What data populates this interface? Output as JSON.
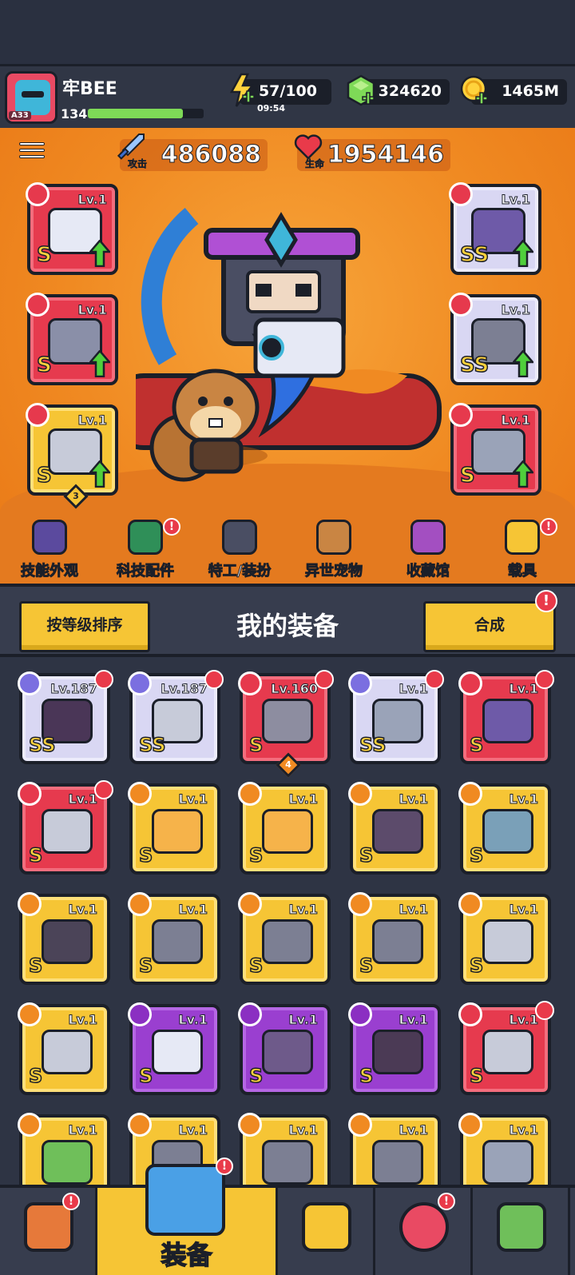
{
  "player": {
    "name": "牢BEE",
    "level": "134",
    "avatar_level": "A33",
    "xp_fraction": 0.82
  },
  "resources": {
    "energy": "57/100",
    "energy_timer": "09:54",
    "gems": "324620",
    "coins": "1465M"
  },
  "stats": {
    "attack_label": "攻击",
    "attack_value": "486088",
    "hp_label": "生命",
    "hp_value": "1954146"
  },
  "equipped_left": [
    {
      "level": "Lv.1",
      "rank": "S",
      "rarity": "red",
      "icon": "blaster-icon",
      "upgradable": true
    },
    {
      "level": "Lv.1",
      "rank": "S",
      "rarity": "red",
      "icon": "spiked-collar-icon",
      "upgradable": true
    },
    {
      "level": "Lv.1",
      "rank": "S",
      "rarity": "gold",
      "icon": "gauntlet-icon",
      "upgradable": true,
      "badge": "3"
    }
  ],
  "equipped_right": [
    {
      "level": "Lv.1",
      "rank": "SS",
      "rarity": "lav",
      "icon": "armor-icon",
      "upgradable": true
    },
    {
      "level": "Lv.1",
      "rank": "SS",
      "rarity": "lav",
      "icon": "belt-icon",
      "upgradable": true
    },
    {
      "level": "Lv.1",
      "rank": "S",
      "rarity": "red",
      "icon": "boot-icon",
      "upgradable": true
    }
  ],
  "hero_nav": [
    {
      "label": "技能外观",
      "icon": "skill-skin-icon",
      "alert": false
    },
    {
      "label": "科技配件",
      "icon": "tech-parts-icon",
      "alert": true
    },
    {
      "label": "特工/装扮",
      "icon": "agent-outfit-icon",
      "alert": false
    },
    {
      "label": "异世宠物",
      "icon": "pet-icon",
      "alert": false
    },
    {
      "label": "收藏馆",
      "icon": "collection-icon",
      "alert": false
    },
    {
      "label": "载具",
      "icon": "vehicle-icon",
      "alert": true
    }
  ],
  "toolbar": {
    "sort_label": "按等级排序",
    "title": "我的装备",
    "merge_label": "合成",
    "merge_alert": "!"
  },
  "inventory": [
    {
      "level": "Lv.187",
      "rank": "SS",
      "rarity": "lav",
      "icon": "staff-icon",
      "equipped": true
    },
    {
      "level": "Lv.187",
      "rank": "SS",
      "rarity": "lav",
      "icon": "glove-icon",
      "equipped": true
    },
    {
      "level": "Lv.160",
      "rank": "S",
      "rarity": "red",
      "icon": "chain-necklace-icon",
      "equipped": true,
      "badge": "4"
    },
    {
      "level": "Lv.1",
      "rank": "SS",
      "rarity": "lav",
      "icon": "boot-icon",
      "equipped": true
    },
    {
      "level": "Lv.1",
      "rank": "S",
      "rarity": "red",
      "icon": "armor-icon",
      "equipped": true
    },
    {
      "level": "Lv.1",
      "rank": "S",
      "rarity": "red",
      "icon": "gauntlet-icon",
      "equipped": true
    },
    {
      "level": "Lv.1",
      "rank": "S",
      "rarity": "gold",
      "icon": "sword-icon",
      "equipped": false
    },
    {
      "level": "Lv.1",
      "rank": "S",
      "rarity": "gold",
      "icon": "sword-icon",
      "equipped": false
    },
    {
      "level": "Lv.1",
      "rank": "S",
      "rarity": "gold",
      "icon": "spiked-blade-icon",
      "equipped": false
    },
    {
      "level": "Lv.1",
      "rank": "S",
      "rarity": "gold",
      "icon": "helmet-armor-icon",
      "equipped": false
    },
    {
      "level": "Lv.1",
      "rank": "S",
      "rarity": "gold",
      "icon": "dark-armor-icon",
      "equipped": false
    },
    {
      "level": "Lv.1",
      "rank": "S",
      "rarity": "gold",
      "icon": "belt-icon",
      "equipped": false
    },
    {
      "level": "Lv.1",
      "rank": "S",
      "rarity": "gold",
      "icon": "belt-icon",
      "equipped": false
    },
    {
      "level": "Lv.1",
      "rank": "S",
      "rarity": "gold",
      "icon": "belt-icon",
      "equipped": false
    },
    {
      "level": "Lv.1",
      "rank": "S",
      "rarity": "gold",
      "icon": "gauntlet-icon",
      "equipped": false
    },
    {
      "level": "Lv.1",
      "rank": "S",
      "rarity": "gold",
      "icon": "gauntlet-icon",
      "equipped": false
    },
    {
      "level": "Lv.1",
      "rank": "S",
      "rarity": "purple",
      "icon": "blaster-icon",
      "equipped": false
    },
    {
      "level": "Lv.1",
      "rank": "S",
      "rarity": "purple",
      "icon": "amulet-icon",
      "equipped": false
    },
    {
      "level": "Lv.1",
      "rank": "S",
      "rarity": "purple",
      "icon": "collar-icon",
      "equipped": false
    },
    {
      "level": "Lv.1",
      "rank": "S",
      "rarity": "red",
      "icon": "gauntlet-icon",
      "equipped": true
    },
    {
      "level": "Lv.1",
      "rank": "",
      "rarity": "gold",
      "icon": "green-gem-armor-icon",
      "equipped": false
    },
    {
      "level": "Lv.1",
      "rank": "",
      "rarity": "gold",
      "icon": "helmet-icon",
      "equipped": false
    },
    {
      "level": "Lv.1",
      "rank": "",
      "rarity": "gold",
      "icon": "belt-icon",
      "equipped": false
    },
    {
      "level": "Lv.1",
      "rank": "",
      "rarity": "gold",
      "icon": "belt-icon",
      "equipped": false
    },
    {
      "level": "Lv.1",
      "rank": "",
      "rarity": "gold",
      "icon": "boot-icon",
      "equipped": false
    }
  ],
  "bottom_nav": [
    {
      "label": "",
      "icon": "shop-icon",
      "alert": true
    },
    {
      "label": "装备",
      "icon": "equipment-icon",
      "alert": true,
      "active": true
    },
    {
      "label": "",
      "icon": "star-swords-icon",
      "alert": false
    },
    {
      "label": "",
      "icon": "planet-icon",
      "alert": true
    },
    {
      "label": "",
      "icon": "dna-capsule-icon",
      "alert": false
    }
  ],
  "colors": {
    "accent": "#f6c535",
    "alert": "#e93a4a",
    "hero_bg": "#f08a22",
    "panel": "#2e3444"
  }
}
